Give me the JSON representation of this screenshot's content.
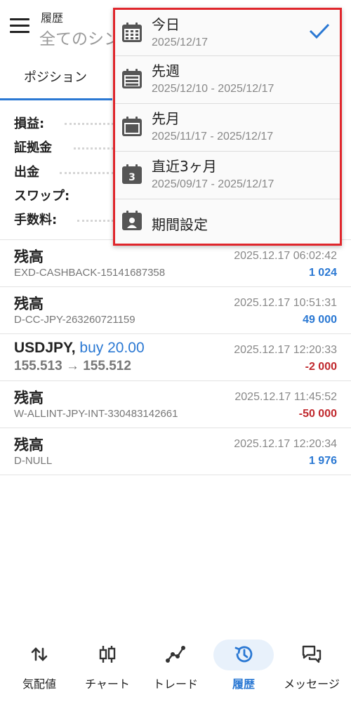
{
  "header": {
    "title": "履歴",
    "subtitle": "全てのシン"
  },
  "tabs": [
    {
      "label": "ポジション",
      "active": true
    }
  ],
  "summary": [
    {
      "label": "損益:"
    },
    {
      "label": "証拠金"
    },
    {
      "label": "出金"
    },
    {
      "label": "スワップ:"
    },
    {
      "label": "手数料:"
    }
  ],
  "rows": [
    {
      "title": "残高",
      "sub": "EXD-CASHBACK-15141687358",
      "datetime": "2025.12.17 06:02:42",
      "amount": "1 024",
      "sign": "pos"
    },
    {
      "title": "残高",
      "sub": "D-CC-JPY-263260721159",
      "datetime": "2025.12.17 10:51:31",
      "amount": "49 000",
      "sign": "pos"
    },
    {
      "symbol": "USDJPY,",
      "action": "buy 20.00",
      "prices": "155.513 → 155.512",
      "datetime": "2025.12.17 12:20:33",
      "amount": "-2 000",
      "sign": "neg"
    },
    {
      "title": "残高",
      "sub": "W-ALLINT-JPY-INT-330483142661",
      "datetime": "2025.12.17 11:45:52",
      "amount": "-50 000",
      "sign": "neg"
    },
    {
      "title": "残高",
      "sub": "D-NULL",
      "datetime": "2025.12.17 12:20:34",
      "amount": "1 976",
      "sign": "pos"
    }
  ],
  "dropdown": {
    "items": [
      {
        "label": "今日",
        "range": "2025/12/17",
        "icon": "calendar-day-icon",
        "selected": true
      },
      {
        "label": "先週",
        "range": "2025/12/10 - 2025/12/17",
        "icon": "calendar-week-icon"
      },
      {
        "label": "先月",
        "range": "2025/11/17 - 2025/12/17",
        "icon": "calendar-month-icon"
      },
      {
        "label": "直近3ヶ月",
        "range": "2025/09/17 - 2025/12/17",
        "icon": "calendar-3-icon",
        "badge": "3"
      },
      {
        "label": "期間設定",
        "icon": "calendar-custom-icon"
      }
    ]
  },
  "bottom_nav": [
    {
      "label": "気配値",
      "icon": "quotes-icon"
    },
    {
      "label": "チャート",
      "icon": "chart-icon"
    },
    {
      "label": "トレード",
      "icon": "trade-icon"
    },
    {
      "label": "履歴",
      "icon": "history-icon",
      "active": true
    },
    {
      "label": "メッセージ",
      "icon": "messages-icon"
    }
  ],
  "colors": {
    "accent": "#2a78d3",
    "negative": "#c0282d",
    "highlight_border": "#e0262c"
  }
}
